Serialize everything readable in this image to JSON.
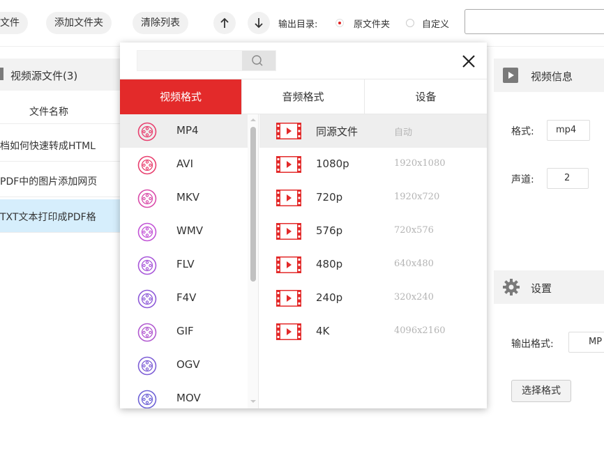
{
  "toolbar": {
    "add_file_partial": "文件",
    "add_folder": "添加文件夹",
    "clear_list": "清除列表",
    "output_dir_label": "输出目录:",
    "output_option_source": "原文件夹",
    "output_option_custom": "自定义",
    "output_path_value": ""
  },
  "file_panel": {
    "title": "视频源文件(3)",
    "column_name": "文件名称",
    "files": [
      "档如何快速转成HTML",
      "PDF中的图片添加网页",
      "TXT文本打印成PDF格"
    ]
  },
  "info_panel": {
    "title": "视频信息",
    "format_label": "格式:",
    "format_value": "mp4",
    "channel_label": "声道:",
    "channel_value": "2"
  },
  "settings_panel": {
    "title": "设置",
    "output_format_label": "输出格式:",
    "output_format_value": "MP",
    "choose_format_button": "选择格式"
  },
  "popup": {
    "search_placeholder": "",
    "tabs": [
      "视频格式",
      "音频格式",
      "设备"
    ],
    "active_tab": 0,
    "formats": [
      "MP4",
      "AVI",
      "MKV",
      "WMV",
      "FLV",
      "F4V",
      "GIF",
      "OGV",
      "MOV"
    ],
    "selected_format": 0,
    "resolutions": [
      {
        "name": "同源文件",
        "dim": "自动"
      },
      {
        "name": "1080p",
        "dim": "1920x1080"
      },
      {
        "name": "720p",
        "dim": "1920x720"
      },
      {
        "name": "576p",
        "dim": "720x576"
      },
      {
        "name": "480p",
        "dim": "640x480"
      },
      {
        "name": "240p",
        "dim": "320x240"
      },
      {
        "name": "4K",
        "dim": "4096x2160"
      }
    ],
    "selected_resolution": 0
  },
  "colors": {
    "accent_red": "#e32a2a",
    "selected_row_blue": "#d6eefc",
    "format_icon_colors": [
      "#e8406f",
      "#e8406f",
      "#d94caa",
      "#c254d6",
      "#a857d9",
      "#8e5ad8",
      "#b25ad0",
      "#7e5fd6",
      "#6e62d6"
    ]
  }
}
